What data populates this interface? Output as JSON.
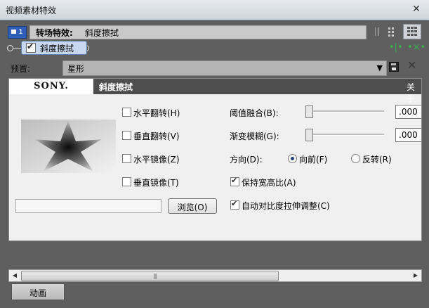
{
  "window": {
    "title": "视频素材特效",
    "close_glyph": "✕"
  },
  "fx_chain": {
    "number": "1",
    "label": "转场特效:",
    "effect_name": "斜度擦拭",
    "chain_item_label": "斜度擦拭",
    "chain_item_checked": true
  },
  "preset": {
    "label": "预置:",
    "value": "星形",
    "arrow": "▼",
    "delete_glyph": "✕"
  },
  "panel": {
    "brand": "SONY.",
    "effect_title": "斜度擦拭",
    "about": "关于",
    "checkboxes": [
      {
        "label": "水平翻转(H)",
        "checked": false
      },
      {
        "label": "垂直翻转(V)",
        "checked": false
      },
      {
        "label": "水平镜像(Z)",
        "checked": false
      },
      {
        "label": "垂直镜像(T)",
        "checked": false
      }
    ],
    "threshold": {
      "label": "阈值融合(B):",
      "value": ".000",
      "level": 0
    },
    "gradient": {
      "label": "渐变模糊(G):",
      "value": ".000",
      "level": 0
    },
    "direction": {
      "label": "方向(D):",
      "options": [
        {
          "label": "向前(F)",
          "selected": true
        },
        {
          "label": "反转(R)",
          "selected": false
        }
      ]
    },
    "keep_aspect": {
      "label": "保持宽高比(A)",
      "checked": true
    },
    "auto_contrast": {
      "label": "自动对比度拉伸调整(C)",
      "checked": true
    },
    "browse_label": "浏览(O)"
  },
  "scrollbar": {
    "left_glyph": "◀",
    "right_glyph": "▶",
    "grip": "|||"
  },
  "animation_button": "动画",
  "colors": {
    "accent": "#2f5fb6",
    "panel_header": "#4e4e4e",
    "chain_green": "#3ab04f"
  }
}
